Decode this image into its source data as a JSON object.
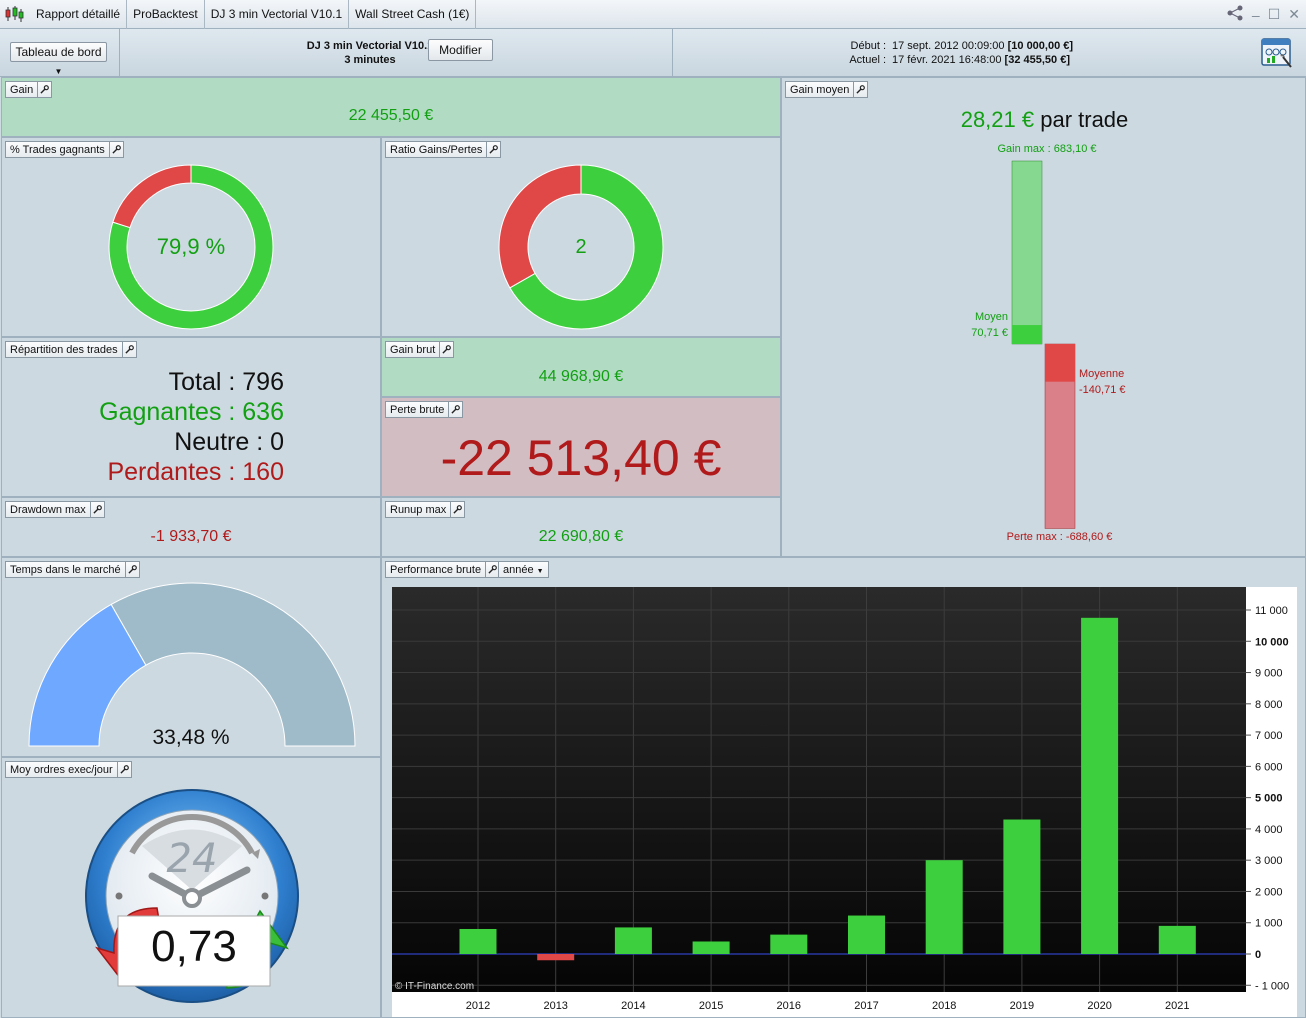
{
  "tabs": [
    "Rapport détaillé",
    "ProBacktest",
    "DJ 3 min Vectorial V10.1",
    "Wall Street Cash (1€)"
  ],
  "header": {
    "dashboard_button": "Tableau de bord",
    "strategy_name": "DJ 3 min Vectorial V10.1",
    "timeframe": "3 minutes",
    "modify_button": "Modifier",
    "start_label": "Début :",
    "start_date": "17 sept. 2012 00:09:00",
    "start_capital": "[10 000,00 €]",
    "current_label": "Actuel :",
    "current_date": "17 févr. 2021 16:48:00",
    "current_capital": "[32 455,50 €]"
  },
  "panels": {
    "gain": {
      "title": "Gain",
      "value": "22 455,50 €"
    },
    "winning_trades": {
      "title": "% Trades gagnants",
      "value": "79,9 %",
      "percent": 79.9
    },
    "ratio": {
      "title": "Ratio Gains/Pertes",
      "value": "2",
      "win_share": 66.7
    },
    "distribution": {
      "title": "Répartition des trades",
      "total_label": "Total : ",
      "total": "796",
      "winning_label": "Gagnantes : ",
      "winning": "636",
      "neutral_label": "Neutre : ",
      "neutral": "0",
      "losing_label": "Perdantes : ",
      "losing": "160"
    },
    "gross_gain": {
      "title": "Gain brut",
      "value": "44 968,90 €"
    },
    "gross_loss": {
      "title": "Perte brute",
      "value": "-22 513,40 €"
    },
    "drawdown": {
      "title": "Drawdown max",
      "value": "-1 933,70 €"
    },
    "runup": {
      "title": "Runup max",
      "value": "22 690,80 €"
    },
    "avg_gain": {
      "title": "Gain moyen",
      "value": "28,21 €",
      "suffix": " par trade",
      "max_gain_label": "Gain max : 683,10 €",
      "avg_win_label": "Moyen",
      "avg_win_value": "70,71 €",
      "avg_loss_label": "Moyenne",
      "avg_loss_value": "-140,71 €",
      "max_loss_label": "Perte max : -688,60 €",
      "max_gain": 683.1,
      "avg_win": 70.71,
      "avg_loss": -140.71,
      "max_loss": -688.6
    },
    "time_in_market": {
      "title": "Temps dans le marché",
      "value": "33,48 %",
      "percent": 33.48
    },
    "orders_per_day": {
      "title": "Moy ordres exec/jour",
      "value": "0,73",
      "clock_label": "24"
    },
    "performance": {
      "title": "Performance brute",
      "period": "année",
      "watermark": "© IT-Finance.com"
    }
  },
  "colors": {
    "green": "#3ecf3e",
    "red": "#e04848",
    "gauge_fill": "#6fa8ff",
    "gauge_bg": "#9fbac8"
  },
  "chart_data": {
    "type": "bar",
    "categories": [
      "2012",
      "2013",
      "2014",
      "2015",
      "2016",
      "2017",
      "2018",
      "2019",
      "2020",
      "2021"
    ],
    "values": [
      800,
      -200,
      850,
      400,
      620,
      1230,
      3000,
      4300,
      10750,
      900
    ],
    "ylim": [
      -1000,
      11000
    ],
    "yticks": [
      -1000,
      0,
      1000,
      2000,
      3000,
      4000,
      5000,
      6000,
      7000,
      8000,
      9000,
      10000,
      11000
    ],
    "ytick_labels": [
      "- 1 000",
      "0",
      "1 000",
      "2 000",
      "3 000",
      "4 000",
      "5 000",
      "6 000",
      "7 000",
      "8 000",
      "9 000",
      "10 000",
      "11 000"
    ],
    "bold_ticks": [
      0,
      5000,
      10000
    ],
    "grid": true
  }
}
